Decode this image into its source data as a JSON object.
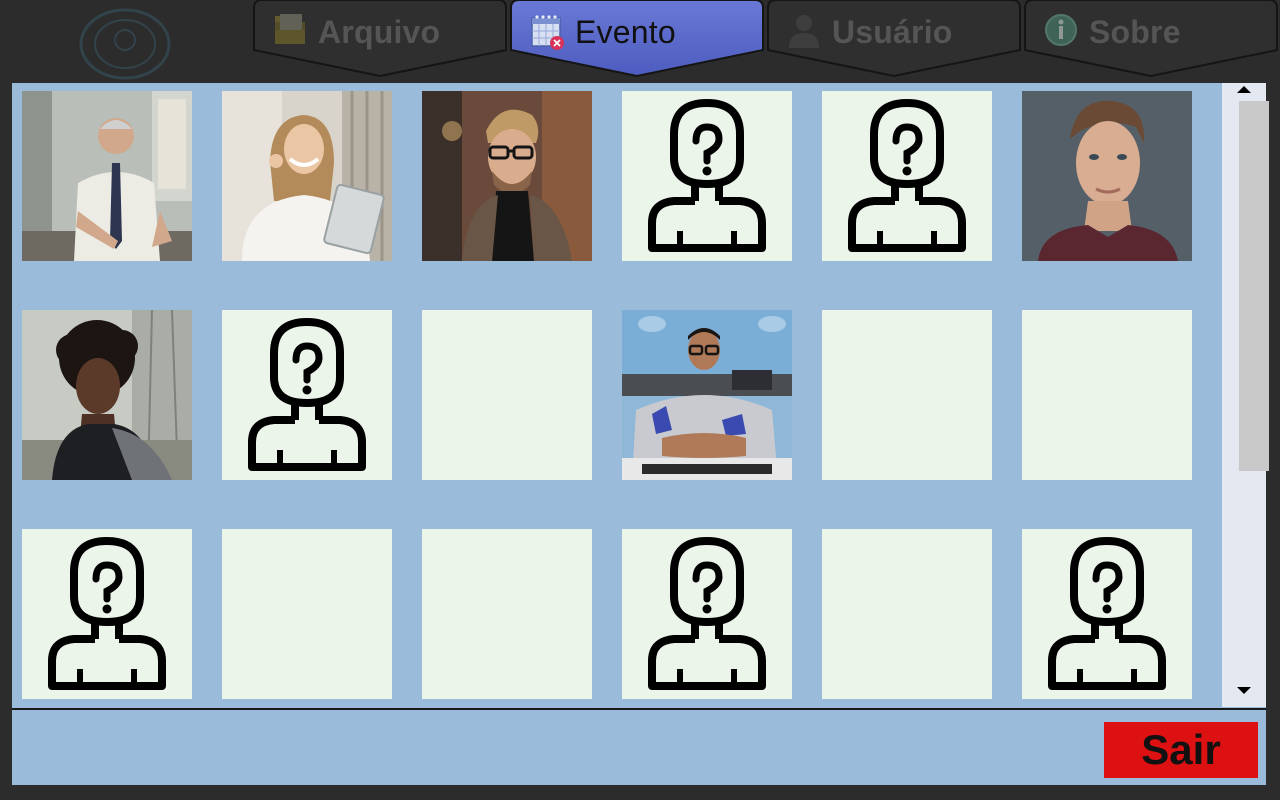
{
  "app": {
    "tabs": [
      {
        "label": "Arquivo",
        "icon": "folder-icon",
        "active": false
      },
      {
        "label": "Evento",
        "icon": "calendar-remove-icon",
        "active": true
      },
      {
        "label": "Usuário",
        "icon": "user-icon",
        "active": false
      },
      {
        "label": "Sobre",
        "icon": "info-icon",
        "active": false
      }
    ]
  },
  "grid": {
    "rows": [
      [
        {
          "type": "photo",
          "icon": "photo-older-man-shirt-tie"
        },
        {
          "type": "photo",
          "icon": "photo-smiling-woman-phone-tablet"
        },
        {
          "type": "photo",
          "icon": "photo-bearded-man-glasses"
        },
        {
          "type": "unknown",
          "icon": "unknown-person-icon"
        },
        {
          "type": "unknown",
          "icon": "unknown-person-icon"
        },
        {
          "type": "photo",
          "icon": "photo-young-man-portrait"
        }
      ],
      [
        {
          "type": "photo",
          "icon": "photo-woman-curly-hair"
        },
        {
          "type": "unknown",
          "icon": "unknown-person-icon"
        },
        {
          "type": "empty",
          "icon": ""
        },
        {
          "type": "photo",
          "icon": "photo-man-glasses-keyboard"
        },
        {
          "type": "empty",
          "icon": ""
        },
        {
          "type": "empty",
          "icon": ""
        }
      ],
      [
        {
          "type": "unknown",
          "icon": "unknown-person-icon"
        },
        {
          "type": "empty",
          "icon": ""
        },
        {
          "type": "empty",
          "icon": ""
        },
        {
          "type": "unknown",
          "icon": "unknown-person-icon"
        },
        {
          "type": "empty",
          "icon": ""
        },
        {
          "type": "unknown",
          "icon": "unknown-person-icon"
        }
      ]
    ]
  },
  "scrollbar": {
    "up_icon": "arrow-up-icon",
    "down_icon": "arrow-down-icon"
  },
  "footer": {
    "exit_label": "Sair"
  },
  "colors": {
    "background": "#2c2c2c",
    "panel": "#9bbbdb",
    "cell": "#ecf5ea",
    "active_tab": "#5565c9",
    "inactive_tab": "#2f2f2f",
    "exit_button": "#dd1111"
  }
}
